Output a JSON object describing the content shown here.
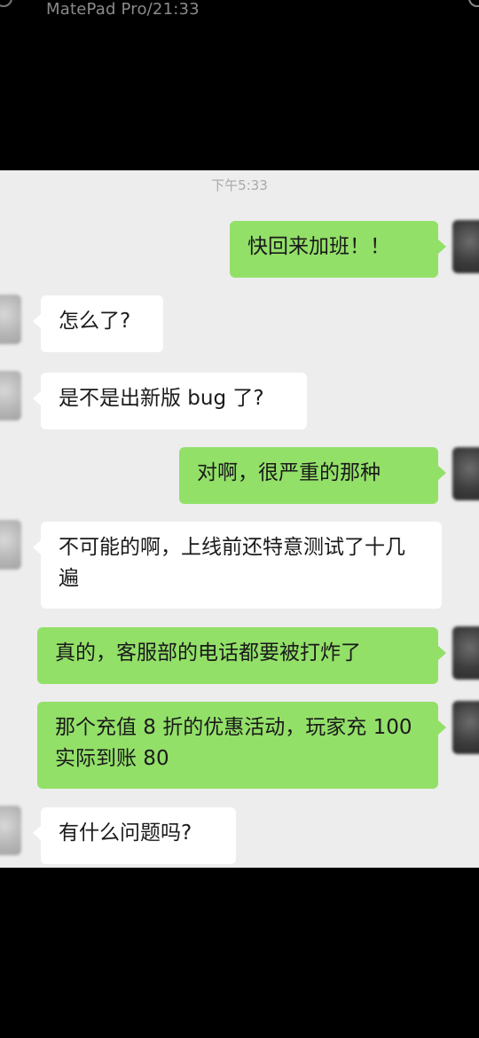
{
  "status_bar": {
    "device_time": "MatePad Pro/21:33"
  },
  "chat": {
    "timestamp": "下午5:33",
    "messages": [
      {
        "side": "out",
        "text": "快回来加班！！"
      },
      {
        "side": "in",
        "text": "怎么了?"
      },
      {
        "side": "in",
        "text": "是不是出新版 bug 了?"
      },
      {
        "side": "out",
        "text": "对啊，很严重的那种"
      },
      {
        "side": "in",
        "text": "不可能的啊，上线前还特意测试了十几遍"
      },
      {
        "side": "out",
        "text": "真的，客服部的电话都要被打炸了"
      },
      {
        "side": "out",
        "text": "那个充值 8 折的优惠活动，玩家充 100 实际到账 80"
      },
      {
        "side": "in",
        "text": "有什么问题吗?"
      }
    ]
  },
  "colors": {
    "outgoing_bubble": "#93e069",
    "incoming_bubble": "#ffffff",
    "chat_background": "#ededed"
  }
}
